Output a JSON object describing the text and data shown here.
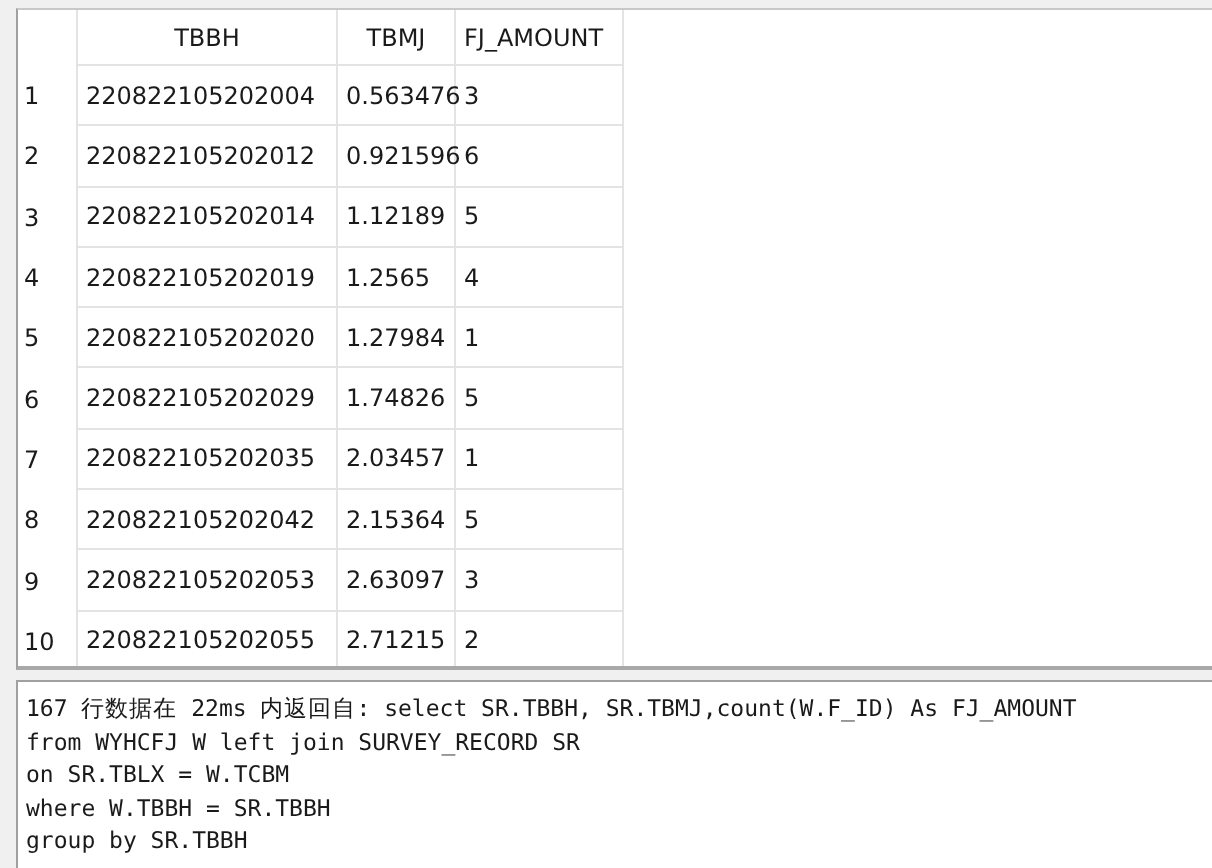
{
  "table": {
    "columns": [
      "TBBH",
      "TBMJ",
      "FJ_AMOUNT"
    ],
    "rows": [
      {
        "number": "1",
        "cells": [
          "220822105202004",
          "0.563476",
          "3"
        ]
      },
      {
        "number": "2",
        "cells": [
          "220822105202012",
          "0.921596",
          "6"
        ]
      },
      {
        "number": "3",
        "cells": [
          "220822105202014",
          "1.12189",
          "5"
        ]
      },
      {
        "number": "4",
        "cells": [
          "220822105202019",
          "1.2565",
          "4"
        ]
      },
      {
        "number": "5",
        "cells": [
          "220822105202020",
          "1.27984",
          "1"
        ]
      },
      {
        "number": "6",
        "cells": [
          "220822105202029",
          "1.74826",
          "5"
        ]
      },
      {
        "number": "7",
        "cells": [
          "220822105202035",
          "2.03457",
          "1"
        ]
      },
      {
        "number": "8",
        "cells": [
          "220822105202042",
          "2.15364",
          "5"
        ]
      },
      {
        "number": "9",
        "cells": [
          "220822105202053",
          "2.63097",
          "3"
        ]
      },
      {
        "number": "10",
        "cells": [
          "220822105202055",
          "2.71215",
          "2"
        ]
      }
    ]
  },
  "message": {
    "lines": [
      "167 行数据在 22ms 内返回自: select SR.TBBH, SR.TBMJ,count(W.F_ID) As FJ_AMOUNT",
      "from WYHCFJ W left join SURVEY_RECORD SR",
      "on SR.TBLX = W.TCBM",
      "where W.TBBH = SR.TBBH",
      "group by SR.TBBH"
    ]
  }
}
